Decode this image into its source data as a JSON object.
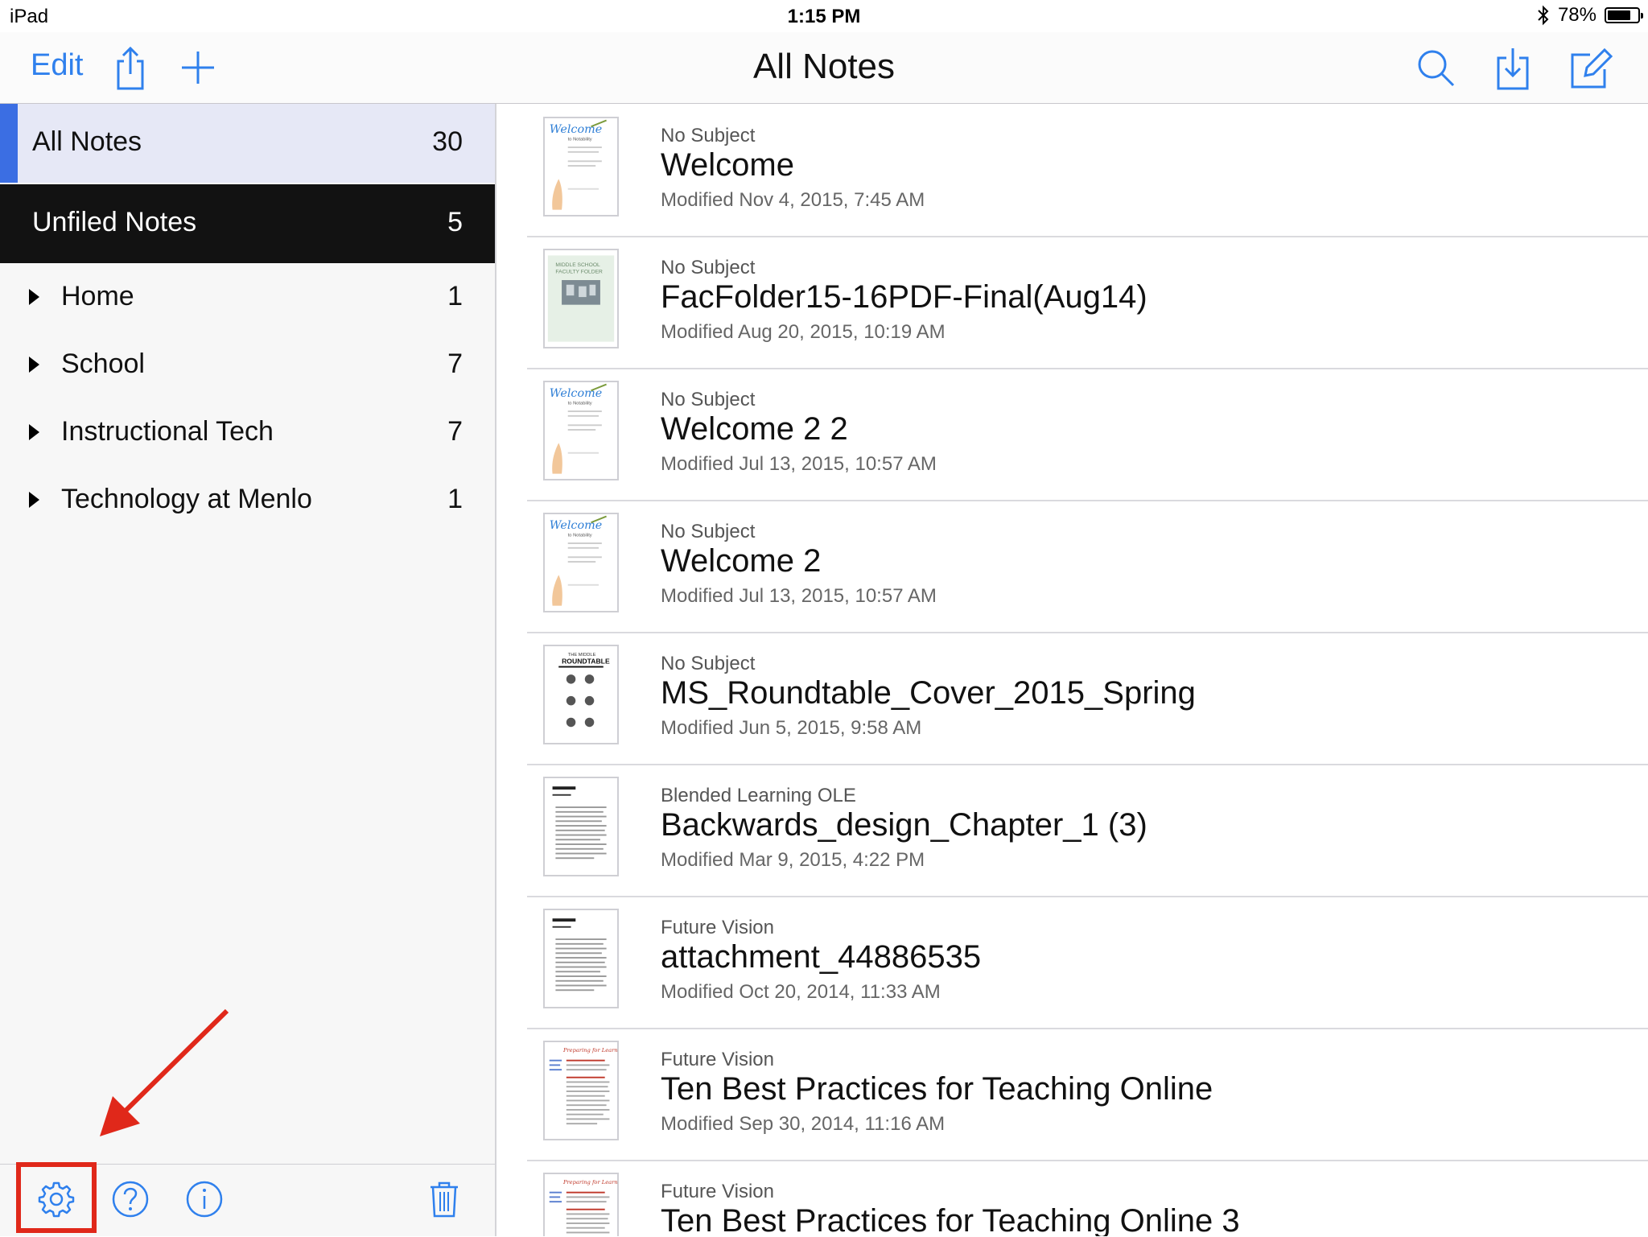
{
  "status_bar": {
    "device": "iPad",
    "time": "1:15 PM",
    "battery": "78%",
    "battery_level": 0.78
  },
  "nav": {
    "edit_label": "Edit",
    "title": "All Notes"
  },
  "sidebar": {
    "all_notes": {
      "label": "All Notes",
      "count": "30"
    },
    "unfiled": {
      "label": "Unfiled Notes",
      "count": "5"
    },
    "folders": [
      {
        "label": "Home",
        "count": "1"
      },
      {
        "label": "School",
        "count": "7"
      },
      {
        "label": "Instructional Tech",
        "count": "7"
      },
      {
        "label": "Technology at Menlo",
        "count": "1"
      }
    ]
  },
  "notes": [
    {
      "subject": "No Subject",
      "title": "Welcome",
      "modified": "Modified Nov 4, 2015, 7:45 AM",
      "thumb": "welcome"
    },
    {
      "subject": "No Subject",
      "title": "FacFolder15-16PDF-Final(Aug14)",
      "modified": "Modified Aug 20, 2015, 10:19 AM",
      "thumb": "folder"
    },
    {
      "subject": "No Subject",
      "title": "Welcome 2 2",
      "modified": "Modified Jul 13, 2015, 10:57 AM",
      "thumb": "welcome"
    },
    {
      "subject": "No Subject",
      "title": "Welcome 2",
      "modified": "Modified Jul 13, 2015, 10:57 AM",
      "thumb": "welcome"
    },
    {
      "subject": "No Subject",
      "title": "MS_Roundtable_Cover_2015_Spring",
      "modified": "Modified Jun 5, 2015, 9:58 AM",
      "thumb": "roundtable"
    },
    {
      "subject": "Blended Learning OLE",
      "title": "Backwards_design_Chapter_1 (3)",
      "modified": "Modified Mar 9, 2015, 4:22 PM",
      "thumb": "document"
    },
    {
      "subject": "Future Vision",
      "title": "attachment_44886535",
      "modified": "Modified Oct 20, 2014, 11:33 AM",
      "thumb": "document"
    },
    {
      "subject": "Future Vision",
      "title": "Ten Best Practices for Teaching Online",
      "modified": "Modified Sep 30, 2014, 11:16 AM",
      "thumb": "document-red"
    },
    {
      "subject": "Future Vision",
      "title": "Ten Best Practices for Teaching Online 3",
      "modified": "",
      "thumb": "document-red"
    }
  ],
  "colors": {
    "accent": "#2f80ed",
    "selected_bar": "#3b6ee3",
    "dark_row": "#121212",
    "annotation": "#e0281a"
  },
  "icons": [
    "bluetooth-icon",
    "share-icon",
    "plus-icon",
    "search-icon",
    "import-icon",
    "compose-icon",
    "settings-gear-icon",
    "help-icon",
    "info-icon",
    "trash-icon"
  ]
}
